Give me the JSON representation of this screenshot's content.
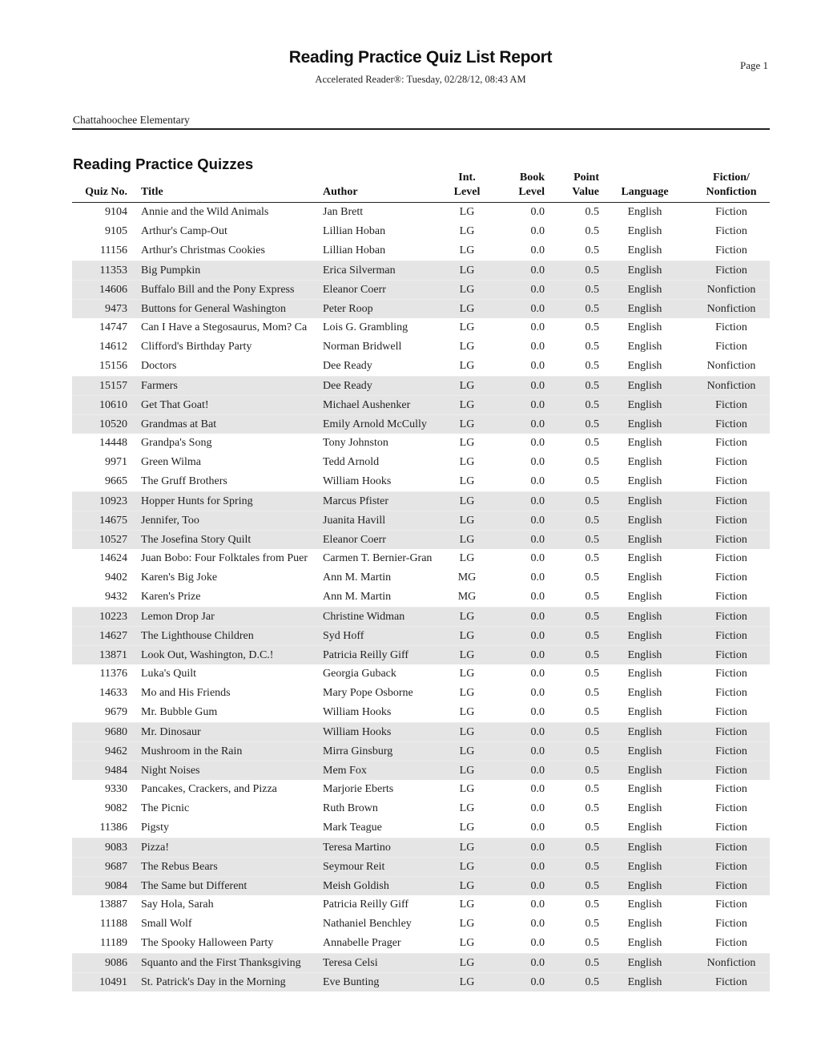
{
  "header": {
    "title": "Reading Practice Quiz List Report",
    "page": "Page 1",
    "subtitle": "Accelerated Reader®:  Tuesday, 02/28/12, 08:43 AM",
    "school": "Chattahoochee Elementary"
  },
  "section": {
    "title": "Reading Practice Quizzes"
  },
  "columns": {
    "quiz_no": [
      "",
      "Quiz No."
    ],
    "title": [
      "",
      "Title"
    ],
    "author": [
      "",
      "Author"
    ],
    "int_level": [
      "Int.",
      "Level"
    ],
    "book_level": [
      "Book",
      "Level"
    ],
    "point_value": [
      "Point",
      "Value"
    ],
    "language": [
      "",
      "Language"
    ],
    "fiction": [
      "Fiction/",
      "Nonfiction"
    ]
  },
  "rows": [
    {
      "quiz": "9104",
      "title": "Annie and the Wild Animals",
      "author": "Jan Brett",
      "int": "LG",
      "book": "0.0",
      "point": "0.5",
      "lang": "English",
      "fic": "Fiction"
    },
    {
      "quiz": "9105",
      "title": "Arthur's Camp-Out",
      "author": "Lillian Hoban",
      "int": "LG",
      "book": "0.0",
      "point": "0.5",
      "lang": "English",
      "fic": "Fiction"
    },
    {
      "quiz": "11156",
      "title": "Arthur's Christmas Cookies",
      "author": "Lillian Hoban",
      "int": "LG",
      "book": "0.0",
      "point": "0.5",
      "lang": "English",
      "fic": "Fiction"
    },
    {
      "quiz": "11353",
      "title": "Big Pumpkin",
      "author": "Erica Silverman",
      "int": "LG",
      "book": "0.0",
      "point": "0.5",
      "lang": "English",
      "fic": "Fiction"
    },
    {
      "quiz": "14606",
      "title": "Buffalo Bill and the Pony Express",
      "author": "Eleanor Coerr",
      "int": "LG",
      "book": "0.0",
      "point": "0.5",
      "lang": "English",
      "fic": "Nonfiction"
    },
    {
      "quiz": "9473",
      "title": "Buttons for General Washington",
      "author": "Peter Roop",
      "int": "LG",
      "book": "0.0",
      "point": "0.5",
      "lang": "English",
      "fic": "Nonfiction"
    },
    {
      "quiz": "14747",
      "title": "Can I Have a Stegosaurus, Mom? Ca",
      "author": "Lois G. Grambling",
      "int": "LG",
      "book": "0.0",
      "point": "0.5",
      "lang": "English",
      "fic": "Fiction"
    },
    {
      "quiz": "14612",
      "title": "Clifford's Birthday Party",
      "author": "Norman Bridwell",
      "int": "LG",
      "book": "0.0",
      "point": "0.5",
      "lang": "English",
      "fic": "Fiction"
    },
    {
      "quiz": "15156",
      "title": "Doctors",
      "author": "Dee Ready",
      "int": "LG",
      "book": "0.0",
      "point": "0.5",
      "lang": "English",
      "fic": "Nonfiction"
    },
    {
      "quiz": "15157",
      "title": "Farmers",
      "author": "Dee Ready",
      "int": "LG",
      "book": "0.0",
      "point": "0.5",
      "lang": "English",
      "fic": "Nonfiction"
    },
    {
      "quiz": "10610",
      "title": "Get That Goat!",
      "author": "Michael Aushenker",
      "int": "LG",
      "book": "0.0",
      "point": "0.5",
      "lang": "English",
      "fic": "Fiction"
    },
    {
      "quiz": "10520",
      "title": "Grandmas at Bat",
      "author": "Emily Arnold McCully",
      "int": "LG",
      "book": "0.0",
      "point": "0.5",
      "lang": "English",
      "fic": "Fiction"
    },
    {
      "quiz": "14448",
      "title": "Grandpa's Song",
      "author": "Tony Johnston",
      "int": "LG",
      "book": "0.0",
      "point": "0.5",
      "lang": "English",
      "fic": "Fiction"
    },
    {
      "quiz": "9971",
      "title": "Green Wilma",
      "author": "Tedd Arnold",
      "int": "LG",
      "book": "0.0",
      "point": "0.5",
      "lang": "English",
      "fic": "Fiction"
    },
    {
      "quiz": "9665",
      "title": "The Gruff Brothers",
      "author": "William Hooks",
      "int": "LG",
      "book": "0.0",
      "point": "0.5",
      "lang": "English",
      "fic": "Fiction"
    },
    {
      "quiz": "10923",
      "title": "Hopper Hunts for Spring",
      "author": "Marcus Pfister",
      "int": "LG",
      "book": "0.0",
      "point": "0.5",
      "lang": "English",
      "fic": "Fiction"
    },
    {
      "quiz": "14675",
      "title": "Jennifer, Too",
      "author": "Juanita Havill",
      "int": "LG",
      "book": "0.0",
      "point": "0.5",
      "lang": "English",
      "fic": "Fiction"
    },
    {
      "quiz": "10527",
      "title": "The Josefina Story Quilt",
      "author": "Eleanor Coerr",
      "int": "LG",
      "book": "0.0",
      "point": "0.5",
      "lang": "English",
      "fic": "Fiction"
    },
    {
      "quiz": "14624",
      "title": "Juan Bobo: Four Folktales from Puer",
      "author": "Carmen T. Bernier-Gran",
      "int": "LG",
      "book": "0.0",
      "point": "0.5",
      "lang": "English",
      "fic": "Fiction"
    },
    {
      "quiz": "9402",
      "title": "Karen's Big Joke",
      "author": "Ann M. Martin",
      "int": "MG",
      "book": "0.0",
      "point": "0.5",
      "lang": "English",
      "fic": "Fiction"
    },
    {
      "quiz": "9432",
      "title": "Karen's Prize",
      "author": "Ann M. Martin",
      "int": "MG",
      "book": "0.0",
      "point": "0.5",
      "lang": "English",
      "fic": "Fiction"
    },
    {
      "quiz": "10223",
      "title": "Lemon Drop Jar",
      "author": "Christine Widman",
      "int": "LG",
      "book": "0.0",
      "point": "0.5",
      "lang": "English",
      "fic": "Fiction"
    },
    {
      "quiz": "14627",
      "title": "The Lighthouse Children",
      "author": "Syd Hoff",
      "int": "LG",
      "book": "0.0",
      "point": "0.5",
      "lang": "English",
      "fic": "Fiction"
    },
    {
      "quiz": "13871",
      "title": "Look Out, Washington, D.C.!",
      "author": "Patricia Reilly Giff",
      "int": "LG",
      "book": "0.0",
      "point": "0.5",
      "lang": "English",
      "fic": "Fiction"
    },
    {
      "quiz": "11376",
      "title": "Luka's Quilt",
      "author": "Georgia Guback",
      "int": "LG",
      "book": "0.0",
      "point": "0.5",
      "lang": "English",
      "fic": "Fiction"
    },
    {
      "quiz": "14633",
      "title": "Mo and His Friends",
      "author": "Mary Pope Osborne",
      "int": "LG",
      "book": "0.0",
      "point": "0.5",
      "lang": "English",
      "fic": "Fiction"
    },
    {
      "quiz": "9679",
      "title": "Mr. Bubble Gum",
      "author": "William Hooks",
      "int": "LG",
      "book": "0.0",
      "point": "0.5",
      "lang": "English",
      "fic": "Fiction"
    },
    {
      "quiz": "9680",
      "title": "Mr. Dinosaur",
      "author": "William Hooks",
      "int": "LG",
      "book": "0.0",
      "point": "0.5",
      "lang": "English",
      "fic": "Fiction"
    },
    {
      "quiz": "9462",
      "title": "Mushroom in the Rain",
      "author": "Mirra Ginsburg",
      "int": "LG",
      "book": "0.0",
      "point": "0.5",
      "lang": "English",
      "fic": "Fiction"
    },
    {
      "quiz": "9484",
      "title": "Night Noises",
      "author": "Mem Fox",
      "int": "LG",
      "book": "0.0",
      "point": "0.5",
      "lang": "English",
      "fic": "Fiction"
    },
    {
      "quiz": "9330",
      "title": "Pancakes, Crackers, and Pizza",
      "author": "Marjorie Eberts",
      "int": "LG",
      "book": "0.0",
      "point": "0.5",
      "lang": "English",
      "fic": "Fiction"
    },
    {
      "quiz": "9082",
      "title": "The Picnic",
      "author": "Ruth Brown",
      "int": "LG",
      "book": "0.0",
      "point": "0.5",
      "lang": "English",
      "fic": "Fiction"
    },
    {
      "quiz": "11386",
      "title": "Pigsty",
      "author": "Mark Teague",
      "int": "LG",
      "book": "0.0",
      "point": "0.5",
      "lang": "English",
      "fic": "Fiction"
    },
    {
      "quiz": "9083",
      "title": "Pizza!",
      "author": "Teresa Martino",
      "int": "LG",
      "book": "0.0",
      "point": "0.5",
      "lang": "English",
      "fic": "Fiction"
    },
    {
      "quiz": "9687",
      "title": "The Rebus Bears",
      "author": "Seymour Reit",
      "int": "LG",
      "book": "0.0",
      "point": "0.5",
      "lang": "English",
      "fic": "Fiction"
    },
    {
      "quiz": "9084",
      "title": "The Same but Different",
      "author": "Meish Goldish",
      "int": "LG",
      "book": "0.0",
      "point": "0.5",
      "lang": "English",
      "fic": "Fiction"
    },
    {
      "quiz": "13887",
      "title": "Say Hola, Sarah",
      "author": "Patricia Reilly Giff",
      "int": "LG",
      "book": "0.0",
      "point": "0.5",
      "lang": "English",
      "fic": "Fiction"
    },
    {
      "quiz": "11188",
      "title": "Small Wolf",
      "author": "Nathaniel Benchley",
      "int": "LG",
      "book": "0.0",
      "point": "0.5",
      "lang": "English",
      "fic": "Fiction"
    },
    {
      "quiz": "11189",
      "title": "The Spooky Halloween Party",
      "author": "Annabelle Prager",
      "int": "LG",
      "book": "0.0",
      "point": "0.5",
      "lang": "English",
      "fic": "Fiction"
    },
    {
      "quiz": "9086",
      "title": "Squanto and the First Thanksgiving",
      "author": "Teresa Celsi",
      "int": "LG",
      "book": "0.0",
      "point": "0.5",
      "lang": "English",
      "fic": "Nonfiction"
    },
    {
      "quiz": "10491",
      "title": "St. Patrick's Day in the Morning",
      "author": "Eve Bunting",
      "int": "LG",
      "book": "0.0",
      "point": "0.5",
      "lang": "English",
      "fic": "Fiction"
    }
  ]
}
